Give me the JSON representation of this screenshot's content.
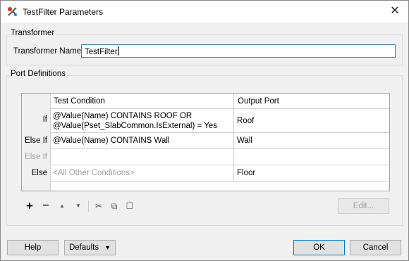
{
  "window": {
    "title": "TestFilter Parameters",
    "close_glyph": "✕"
  },
  "transformer": {
    "group_label": "Transformer",
    "name_label": "Transformer Name:",
    "name_value": "TestFilter"
  },
  "ports": {
    "group_label": "Port Definitions",
    "columns": [
      "Test Condition",
      "Output Port"
    ],
    "rows": [
      {
        "label": "If",
        "condition_line1": "@Value(Name) CONTAINS ROOF OR",
        "condition_line2": "@Value(Pset_SlabCommon.IsExternal) = Yes",
        "output": "Roof"
      },
      {
        "label": "Else If",
        "condition": "@Value(Name) CONTAINS Wall",
        "output": "Wall"
      },
      {
        "label": "Else If",
        "condition": "",
        "output": ""
      },
      {
        "label": "Else",
        "condition": "<All Other Conditions>",
        "output": "Floor"
      }
    ]
  },
  "toolbar": {
    "add_glyph": "+",
    "remove_glyph": "−",
    "up_glyph": "▲",
    "down_glyph": "▼",
    "cut_glyph": "✂",
    "copy_glyph": "⧉",
    "paste_glyph": "📋",
    "edit_label": "Edit..."
  },
  "buttons": {
    "help": "Help",
    "defaults": "Defaults",
    "defaults_arrow": "▼",
    "ok": "OK",
    "cancel": "Cancel"
  },
  "colors": {
    "focus_border": "#3f7fcd",
    "primary_border": "#0078d7"
  }
}
